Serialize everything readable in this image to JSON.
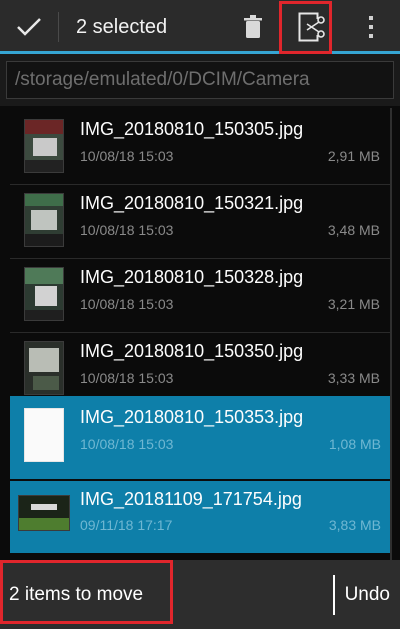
{
  "actionbar": {
    "title": "2 selected",
    "accent": "#36a5d3"
  },
  "path": {
    "value": "/storage/emulated/0/DCIM/Camera"
  },
  "files": [
    {
      "name": "IMG_20180810_150305.jpg",
      "date": "10/08/18 15:03",
      "size": "2,91 MB",
      "selected": false
    },
    {
      "name": "IMG_20180810_150321.jpg",
      "date": "10/08/18 15:03",
      "size": "3,48 MB",
      "selected": false
    },
    {
      "name": "IMG_20180810_150328.jpg",
      "date": "10/08/18 15:03",
      "size": "3,21 MB",
      "selected": false
    },
    {
      "name": "IMG_20180810_150350.jpg",
      "date": "10/08/18 15:03",
      "size": "3,33 MB",
      "selected": false
    },
    {
      "name": "IMG_20180810_150353.jpg",
      "date": "10/08/18 15:03",
      "size": "1,08 MB",
      "selected": true
    },
    {
      "name": "IMG_20181109_171754.jpg",
      "date": "09/11/18 17:17",
      "size": "3,83 MB",
      "selected": true
    }
  ],
  "snackbar": {
    "message": "2 items to move",
    "action": "Undo"
  },
  "colors": {
    "selected_row": "#0e7fa9",
    "highlight": "#e0262c"
  },
  "icons": [
    "check-icon",
    "trash-icon",
    "cut-icon",
    "overflow-menu-icon"
  ]
}
